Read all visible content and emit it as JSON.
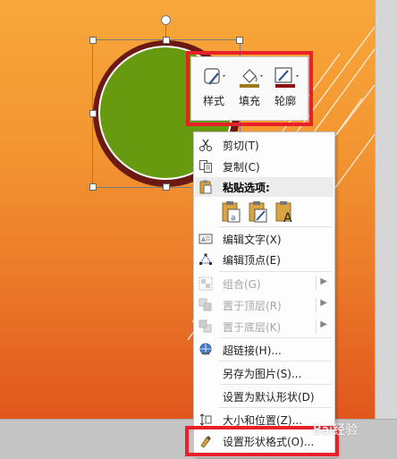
{
  "mini_toolbar": {
    "style_label": "样式",
    "fill_label": "填充",
    "outline_label": "轮廓",
    "fill_color": "#a07a1c",
    "outline_color": "#8a1010"
  },
  "context_menu": {
    "cut": "剪切(T)",
    "copy": "复制(C)",
    "paste_options": "粘贴选项:",
    "edit_text": "编辑文字(X)",
    "edit_points": "编辑顶点(E)",
    "group": "组合(G)",
    "bring_to_front": "置于顶层(R)",
    "send_to_back": "置于底层(K)",
    "hyperlink": "超链接(H)...",
    "save_as_picture": "另存为图片(S)...",
    "set_default_shape": "设置为默认形状(D)",
    "size_position": "大小和位置(Z)...",
    "format_shape": "设置形状格式(O)..."
  },
  "colors": {
    "highlight_red": "#e8202a",
    "shape_fill": "#679a0f",
    "shape_outline": "#6a1a12"
  },
  "watermark": "Bai经验"
}
